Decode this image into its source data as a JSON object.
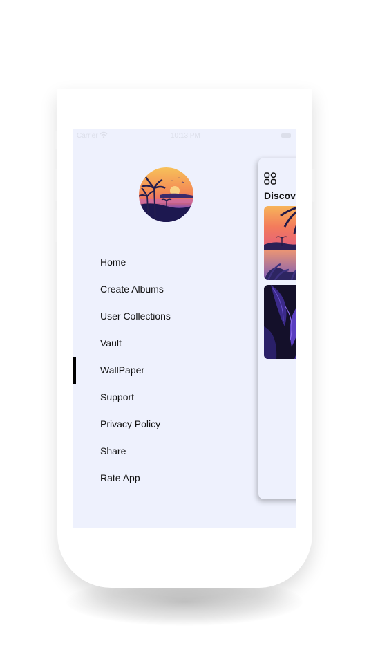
{
  "status_bar": {
    "carrier": "Carrier",
    "wifi_icon": "wifi-icon",
    "time": "10:13 PM",
    "battery_icon": "battery-icon"
  },
  "drawer": {
    "avatar_icon": "tropical-sunset-avatar",
    "selected_item": "WallPaper",
    "items": [
      {
        "label": "Home"
      },
      {
        "label": "Create Albums"
      },
      {
        "label": "User Collections"
      },
      {
        "label": "Vault"
      },
      {
        "label": "WallPaper"
      },
      {
        "label": "Support"
      },
      {
        "label": "Privacy Policy"
      },
      {
        "label": "Share"
      },
      {
        "label": "Rate App"
      }
    ]
  },
  "main_preview": {
    "menu_icon": "grid-icon",
    "title": "Discove",
    "wallpapers": [
      {
        "name": "tropical-sunset-wallpaper"
      },
      {
        "name": "purple-leaves-wallpaper"
      }
    ]
  },
  "colors": {
    "screen_background": "#eef1fd",
    "menu_text": "#111111",
    "selection_indicator": "#000000"
  }
}
